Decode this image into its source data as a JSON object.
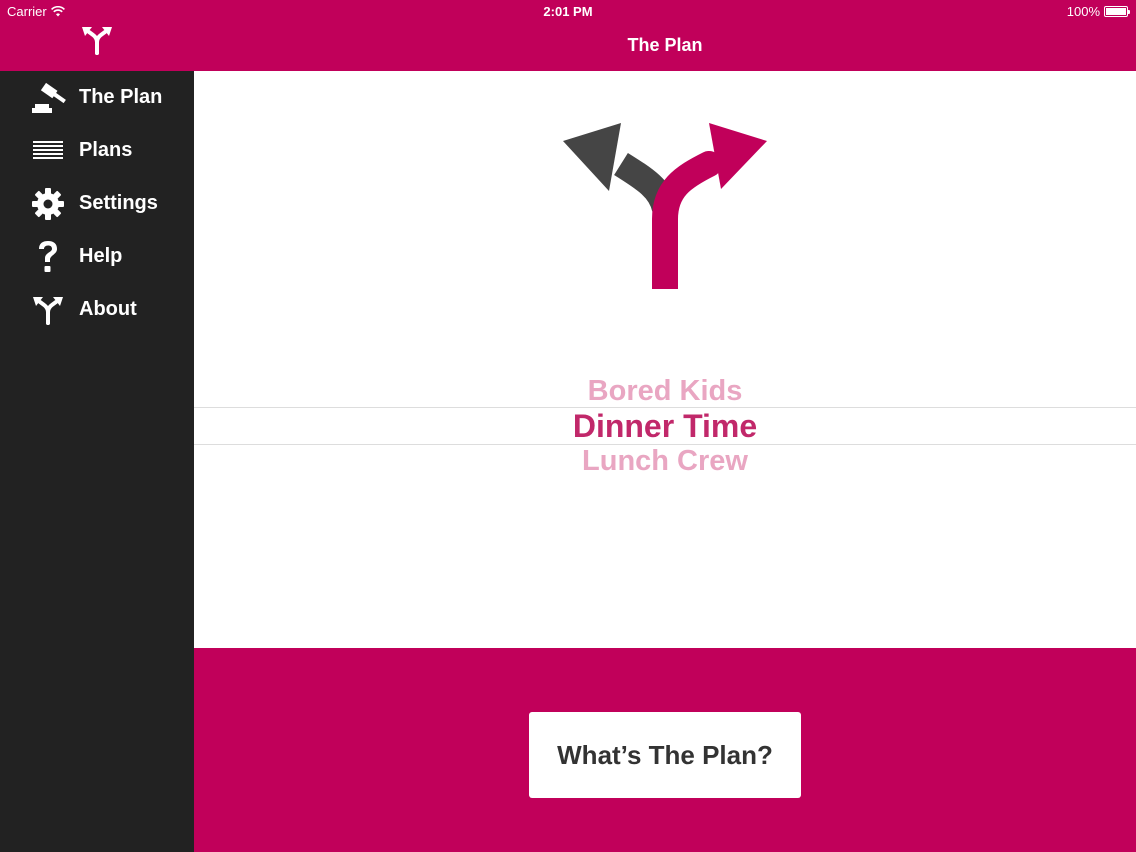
{
  "status_bar": {
    "carrier": "Carrier",
    "time": "2:01 PM",
    "battery": "100%"
  },
  "colors": {
    "brand": "#c1005a",
    "sidebar_bg": "#222222",
    "selected_option": "#c1286a",
    "faded_option": "#e9a6c2"
  },
  "sidebar": {
    "logo_icon": "split-arrows-icon",
    "items": [
      {
        "label": "The Plan",
        "icon": "gavel-icon"
      },
      {
        "label": "Plans",
        "icon": "list-lines-icon"
      },
      {
        "label": "Settings",
        "icon": "gear-icon"
      },
      {
        "label": "Help",
        "icon": "question-mark-icon"
      },
      {
        "label": "About",
        "icon": "split-arrows-icon"
      }
    ]
  },
  "navbar": {
    "title": "The Plan"
  },
  "picker": {
    "options": [
      "Bored Kids",
      "Dinner Time",
      "Lunch Crew"
    ],
    "selected": "Dinner Time"
  },
  "bottom": {
    "button_label": "What’s The Plan?"
  }
}
